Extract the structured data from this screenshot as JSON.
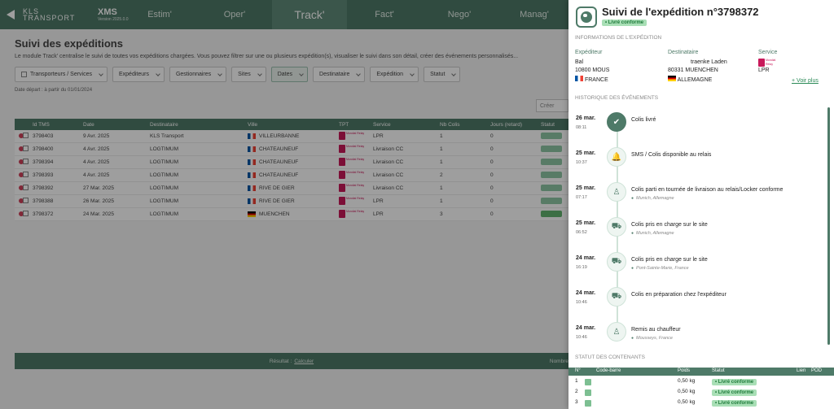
{
  "brand": {
    "logo_text_1": "KLS",
    "logo_text_2": "TRANSPORT",
    "app": "XMS",
    "version": "Version 2025.0.0"
  },
  "nav": {
    "tabs": [
      "Estim'",
      "Oper'",
      "Track'",
      "Fact'",
      "Nego'",
      "Manag'"
    ],
    "active": "Track'"
  },
  "page": {
    "title": "Suivi des expéditions",
    "description": "Le module Track' centralise le suivi de toutes vos expéditions chargées. Vous pouvez filtrer sur une ou plusieurs expédition(s), visualiser le suivi dans son détail, créer des événements personnalisés...",
    "filters": [
      "Transporteurs / Services",
      "Expéditeurs",
      "Gestionnaires",
      "Sites",
      "Dates",
      "Destinataire",
      "Expédition",
      "Statut"
    ],
    "active_filter": "Dates",
    "date_note": "Date départ : à partir du 01/01/2024",
    "export_label": "Créer"
  },
  "table": {
    "headers": [
      "Id TMS",
      "Date",
      "Destinataire",
      "Ville",
      "TPT",
      "Service",
      "Nb Colis",
      "Jours (retard)",
      "Statut"
    ],
    "rows": [
      {
        "id": "3798403",
        "date": "9 Avr. 2025",
        "dest": "KLS Transport",
        "ville": "VILLEURBANNE",
        "flag": "fr",
        "service": "LPR",
        "nb": "1",
        "jours": "0",
        "status": "light"
      },
      {
        "id": "3798400",
        "date": "4 Avr. 2025",
        "dest": "LOGTIMUM",
        "ville": "CHATEAUNEUF",
        "flag": "fr",
        "service": "Livraison CC",
        "nb": "1",
        "jours": "0",
        "status": "light"
      },
      {
        "id": "3798394",
        "date": "4 Avr. 2025",
        "dest": "LOGTIMUM",
        "ville": "CHATEAUNEUF",
        "flag": "fr",
        "service": "Livraison CC",
        "nb": "1",
        "jours": "0",
        "status": "light"
      },
      {
        "id": "3798393",
        "date": "4 Avr. 2025",
        "dest": "LOGTIMUM",
        "ville": "CHATEAUNEUF",
        "flag": "fr",
        "service": "Livraison CC",
        "nb": "2",
        "jours": "0",
        "status": "light"
      },
      {
        "id": "3798392",
        "date": "27 Mar. 2025",
        "dest": "LOGTIMUM",
        "ville": "RIVE DE GIER",
        "flag": "fr",
        "service": "Livraison CC",
        "nb": "1",
        "jours": "0",
        "status": "light"
      },
      {
        "id": "3798388",
        "date": "26 Mar. 2025",
        "dest": "LOGTIMUM",
        "ville": "RIVE DE GIER",
        "flag": "fr",
        "service": "LPR",
        "nb": "1",
        "jours": "0",
        "status": "light"
      },
      {
        "id": "3798372",
        "date": "24 Mar. 2025",
        "dest": "LOGTIMUM",
        "ville": "MUENCHEN",
        "flag": "de",
        "service": "LPR",
        "nb": "3",
        "jours": "0",
        "status": "green"
      }
    ],
    "footer_result": "Résultat :",
    "footer_link": "Calculer",
    "footer_nb": "Nombre"
  },
  "panel": {
    "title": "Suivi de l'expédition n°3798372",
    "status_badge": "• Livré conforme",
    "info_header": "INFORMATIONS DE L'EXPÉDITION",
    "expediteur_label": "Expéditeur",
    "expediteur": [
      "Bal",
      "10800 MOUS",
      "FRANCE"
    ],
    "destinataire_label": "Destinataire",
    "destinataire": [
      "traenke Laden",
      "80331 MUENCHEN",
      "ALLEMAGNE"
    ],
    "service_label": "Service",
    "service": "LPR",
    "voir_plus": "+ Voir plus",
    "history_header": "HISTORIQUE DES ÉVÉNEMENTS",
    "events": [
      {
        "date": "26 mar.",
        "time": "08:11",
        "label": "Colis livré",
        "loc": "",
        "icon": "check-icon",
        "glyph": "✔",
        "done": true
      },
      {
        "date": "25 mar.",
        "time": "10:37",
        "label": "SMS / Colis disponible au relais",
        "loc": "",
        "icon": "bell-icon",
        "glyph": "🔔",
        "done": false
      },
      {
        "date": "25 mar.",
        "time": "07:17",
        "label": "Colis parti en tournée de livraison au relais/Locker conforme",
        "loc": "Munich, Allemagne",
        "icon": "delivery-person-icon",
        "glyph": "♙",
        "done": false
      },
      {
        "date": "25 mar.",
        "time": "06:52",
        "label": "Colis pris en charge sur le site",
        "loc": "Munich, Allemagne",
        "icon": "truck-icon",
        "glyph": "⛟",
        "done": false
      },
      {
        "date": "24 mar.",
        "time": "16:19",
        "label": "Colis pris en charge sur le site",
        "loc": "Pont-Sainte-Marie, France",
        "icon": "truck-icon",
        "glyph": "⛟",
        "done": false
      },
      {
        "date": "24 mar.",
        "time": "10:46",
        "label": "Colis en préparation chez l'expéditeur",
        "loc": "",
        "icon": "truck-icon",
        "glyph": "⛟",
        "done": false
      },
      {
        "date": "24 mar.",
        "time": "10:46",
        "label": "Remis au chauffeur",
        "loc": "Mousseys, France",
        "icon": "handover-icon",
        "glyph": "♙",
        "done": false
      }
    ],
    "contents_header": "STATUT DES CONTENANTS",
    "contents_columns": [
      "N°",
      "Code-barre",
      "Poids",
      "Statut",
      "Lien",
      "POD"
    ],
    "contents": [
      {
        "n": "1",
        "poids": "0,50 kg",
        "statut": "• Livré conforme"
      },
      {
        "n": "2",
        "poids": "0,50 kg",
        "statut": "• Livré conforme"
      },
      {
        "n": "3",
        "poids": "0,50 kg",
        "statut": "• Livré conforme"
      }
    ]
  }
}
